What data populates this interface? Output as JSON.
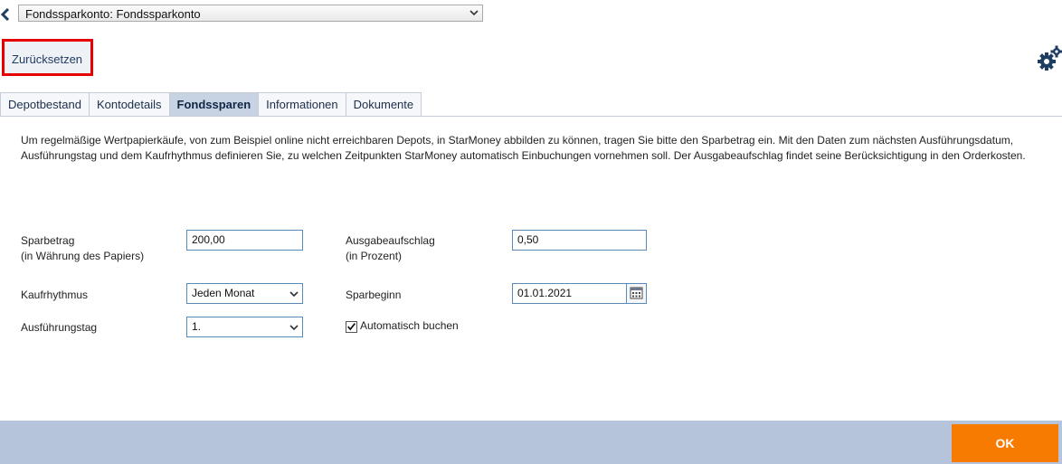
{
  "header": {
    "account_select": "Fondssparkonto: Fondssparkonto",
    "reset_label": "Zurücksetzen"
  },
  "tabs": [
    {
      "label": "Depotbestand",
      "active": false
    },
    {
      "label": "Kontodetails",
      "active": false
    },
    {
      "label": "Fondssparen",
      "active": true
    },
    {
      "label": "Informationen",
      "active": false
    },
    {
      "label": "Dokumente",
      "active": false
    }
  ],
  "description": "Um regelmäßige Wertpapierkäufe, von zum Beispiel online nicht erreichbaren Depots, in StarMoney abbilden zu können, tragen Sie bitte den Sparbetrag ein. Mit den Daten zum nächsten Ausführungsdatum, Ausführungstag und dem Kaufrhythmus definieren Sie, zu welchen Zeitpunkten StarMoney automatisch Einbuchungen vornehmen soll. Der Ausgabeaufschlag findet seine Berücksichtigung in den Orderkosten.",
  "form": {
    "sparbetrag": {
      "label": "Sparbetrag",
      "sublabel": "(in Währung des Papiers)",
      "value": "200,00"
    },
    "ausgabeaufschlag": {
      "label": "Ausgabeaufschlag",
      "sublabel": "(in Prozent)",
      "value": "0,50"
    },
    "kaufrhythmus": {
      "label": "Kaufrhythmus",
      "value": "Jeden Monat"
    },
    "sparbeginn": {
      "label": "Sparbeginn",
      "value": "01.01.2021"
    },
    "ausfuehrungstag": {
      "label": "Ausführungstag",
      "value": "1."
    },
    "automatisch_buchen": {
      "label": "Automatisch buchen",
      "checked": true
    }
  },
  "footer": {
    "ok_label": "OK"
  },
  "colors": {
    "accent": "#f77b00",
    "footer": "#b5c4da",
    "tab_active": "#c7d3e3",
    "highlight": "#e60000"
  }
}
